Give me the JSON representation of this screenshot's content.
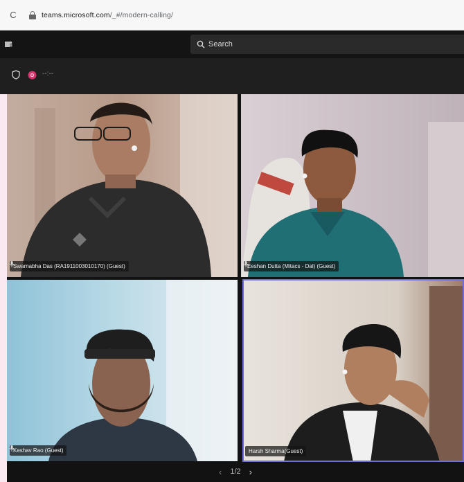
{
  "browser": {
    "reload_glyph": "C",
    "url_host": "teams.microsoft.com",
    "url_path": "/_#/modern-calling/"
  },
  "header": {
    "search_placeholder": "Search"
  },
  "meeting": {
    "timer": "--:--"
  },
  "participants": [
    {
      "name": "Swarnabha Das (RA1911003010170) (Guest)",
      "active": false
    },
    {
      "name": "Eeshan Dutta (Mitacs - Dal) (Guest)",
      "active": false
    },
    {
      "name": "Keshav Rao (Guest)",
      "active": false
    },
    {
      "name": "Harsh Sharma(Guest)",
      "active": true
    }
  ],
  "pager": {
    "label": "1/2",
    "prev_glyph": "‹",
    "next_glyph": "›"
  },
  "colors": {
    "accent": "#6d6fd6",
    "record": "#d6336c"
  }
}
